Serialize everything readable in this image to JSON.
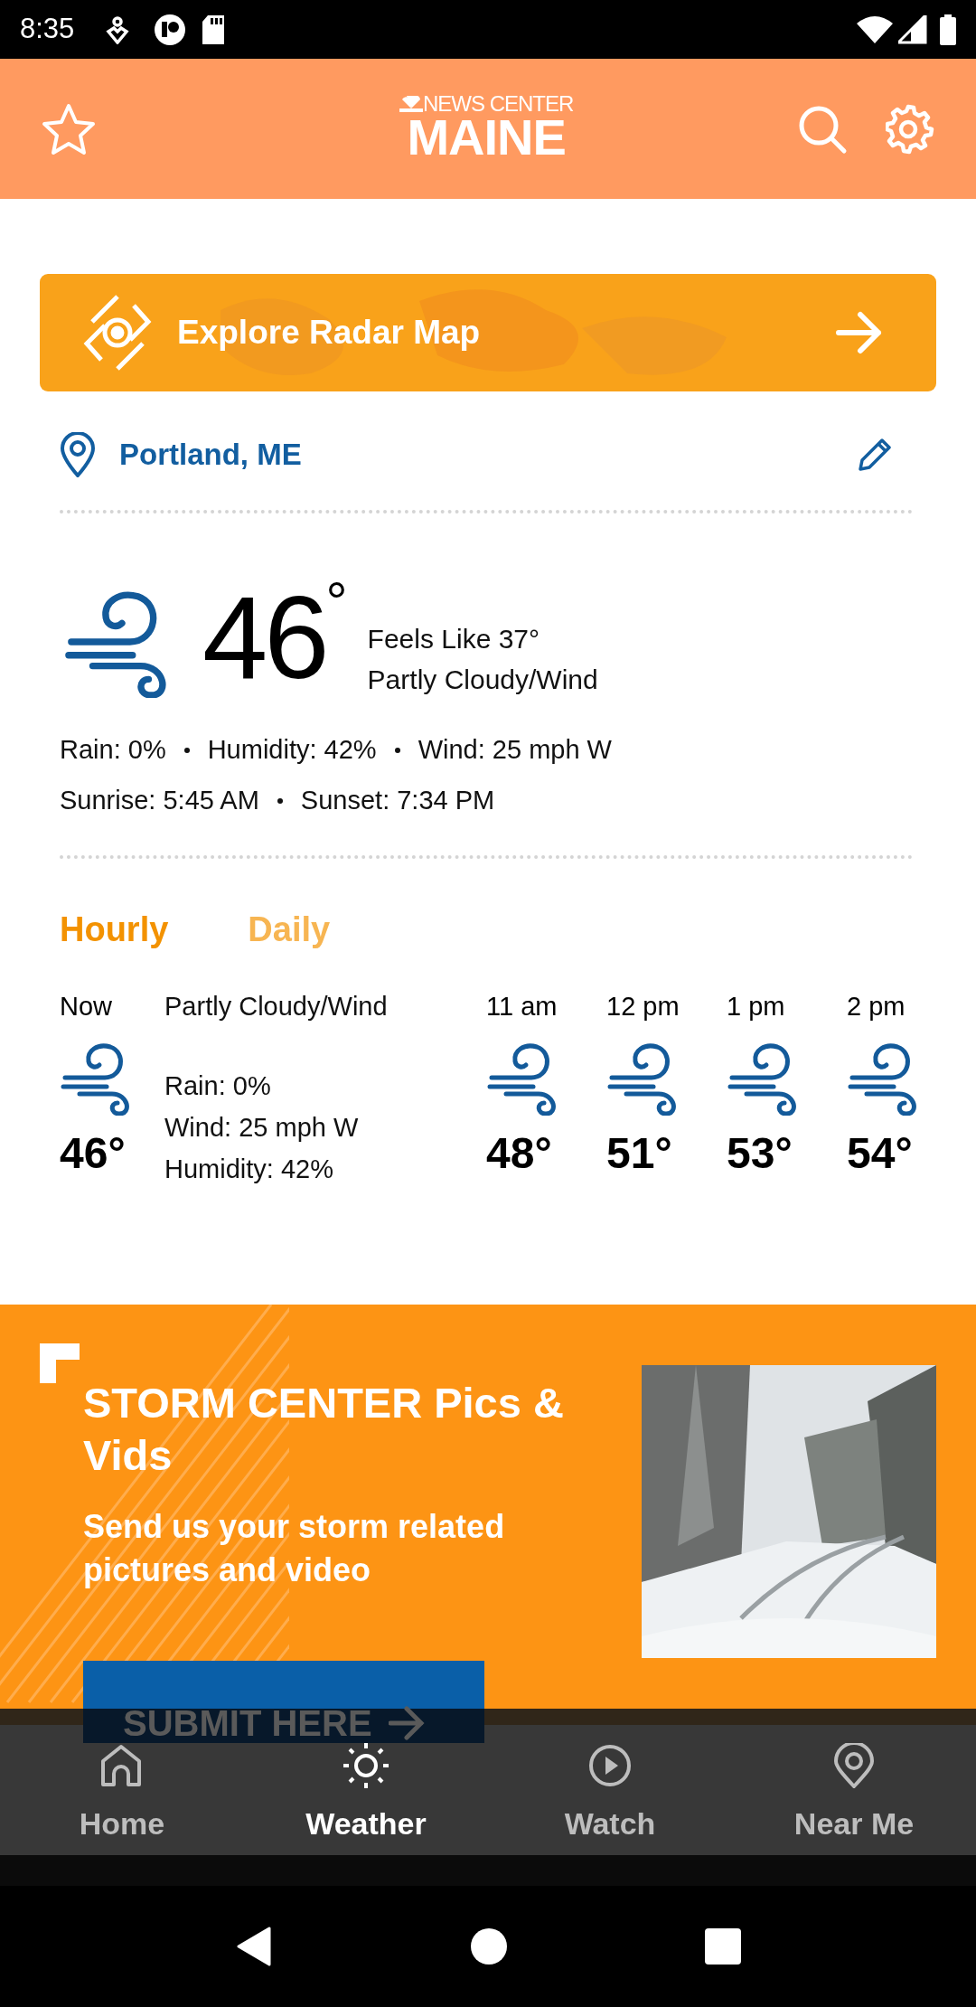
{
  "status_bar": {
    "time": "8:35"
  },
  "header": {
    "logo_top": "NEWS CENTER",
    "logo_bottom": "MAINE"
  },
  "radar_button": {
    "label": "Explore Radar Map"
  },
  "location": {
    "name": "Portland, ME"
  },
  "current": {
    "temperature": "46",
    "degree": "°",
    "feels_like": "Feels Like 37°",
    "condition": "Partly Cloudy/Wind",
    "detail_lines": [
      {
        "items": [
          "Rain: 0%",
          "Humidity: 42%",
          "Wind: 25 mph W"
        ]
      },
      {
        "items": [
          "Sunrise: 5:45 AM",
          "Sunset: 7:34 PM"
        ]
      }
    ]
  },
  "forecast_tabs": [
    {
      "label": "Hourly",
      "selected": true
    },
    {
      "label": "Daily",
      "selected": false
    }
  ],
  "hourly": {
    "now": {
      "time": "Now",
      "temperature": "46°",
      "summary": "Partly Cloudy/Wind",
      "details": [
        "Rain: 0%",
        "Wind: 25 mph W",
        "Humidity: 42%"
      ]
    },
    "hours": [
      {
        "time": "11 am",
        "temperature": "48°"
      },
      {
        "time": "12 pm",
        "temperature": "51°"
      },
      {
        "time": "1 pm",
        "temperature": "53°"
      },
      {
        "time": "2 pm",
        "temperature": "54°"
      }
    ]
  },
  "promo": {
    "title": "STORM CENTER Pics & Vids",
    "subtitle": "Send us your storm related pictures and video",
    "button": "SUBMIT HERE"
  },
  "bottom_nav": [
    {
      "label": "Home",
      "selected": false
    },
    {
      "label": "Weather",
      "selected": true
    },
    {
      "label": "Watch",
      "selected": false
    },
    {
      "label": "Near Me",
      "selected": false
    }
  ]
}
